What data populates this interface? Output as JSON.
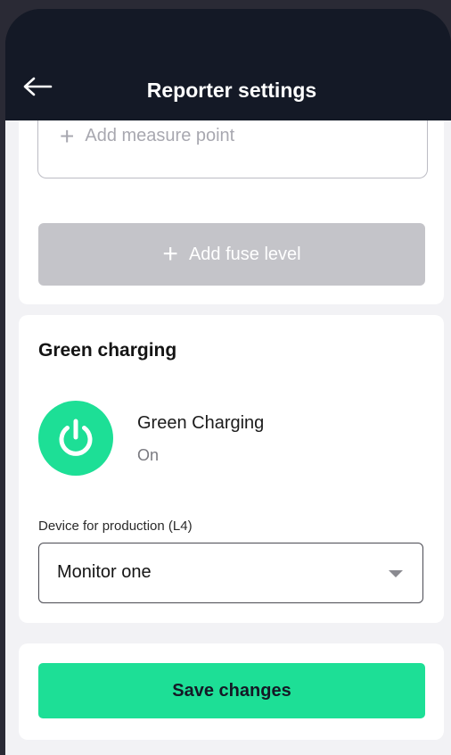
{
  "header": {
    "title": "Reporter settings",
    "back_icon": "arrow-left-icon"
  },
  "measure": {
    "add_label": "Add measure point",
    "plus_glyph": "+"
  },
  "fuse": {
    "add_label": "Add fuse level",
    "plus_glyph": "+"
  },
  "green_charging": {
    "section_title": "Green charging",
    "toggle_label": "Green Charging",
    "toggle_status": "On",
    "device_label": "Device for production (L4)",
    "device_value": "Monitor one"
  },
  "actions": {
    "save_label": "Save changes"
  },
  "colors": {
    "accent": "#1ddf96",
    "header_bg": "#141926",
    "disabled_button": "#c4c4c9"
  }
}
